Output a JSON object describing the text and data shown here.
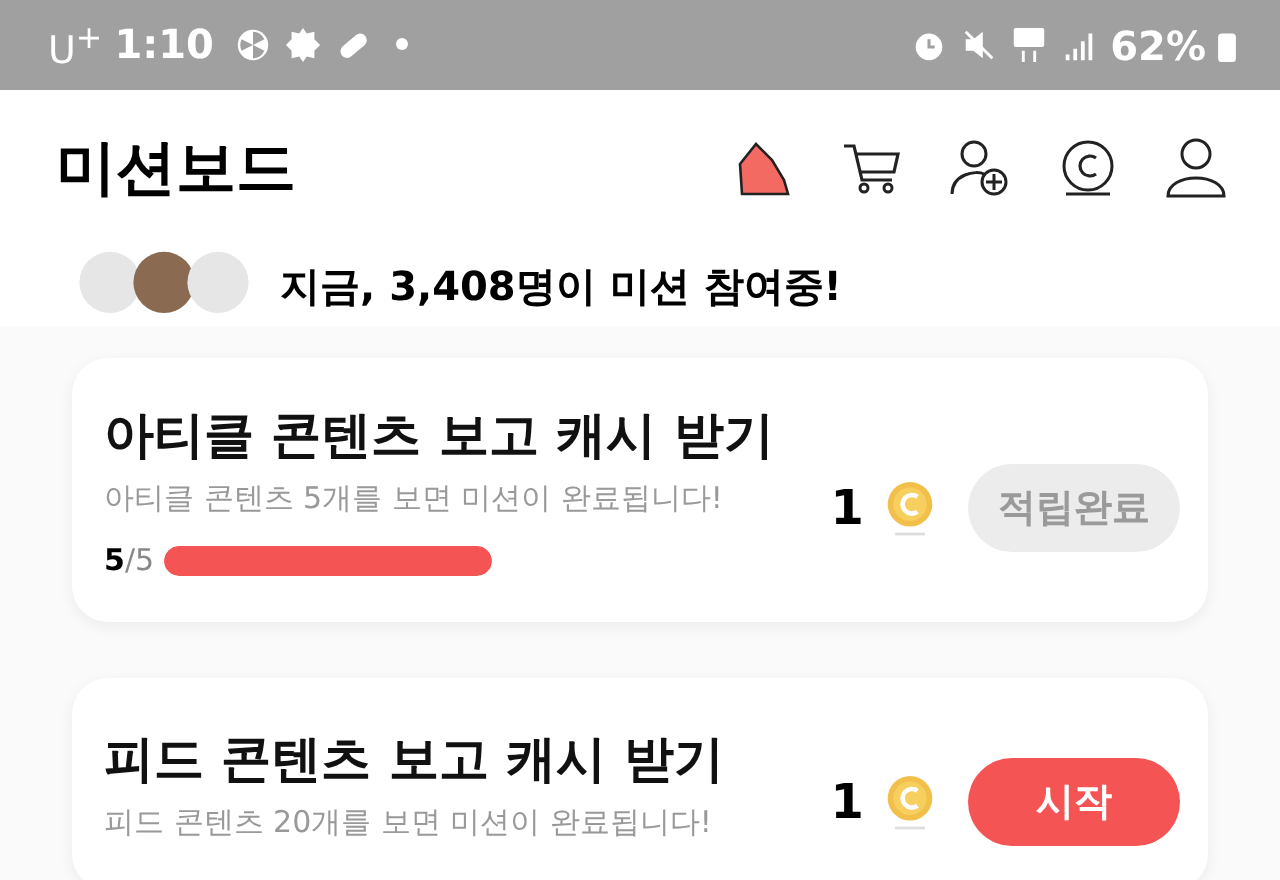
{
  "status_bar": {
    "carrier": "U$^{+}$",
    "time": "1:10",
    "battery": "62%"
  },
  "header": {
    "title": "미션보드"
  },
  "banner": {
    "text": "지금, **3,408명**이 미션 참여중!"
  },
  "missions": [
    {
      "title": "아티클 콘텐츠 보고 캐시 받기",
      "description": "아티클 콘텐츠 5개를 보면 미션이 완료됩니다!",
      "reward": "1",
      "progress": {
        "current": "5",
        "total": "/5",
        "level": 1
      },
      "button": {
        "label": "적립완료",
        "disabled": true
      }
    },
    {
      "title": "피드 콘텐츠 보고 캐시 받기",
      "description": "피드 콘텐츠 20개를 보면 미션이 완료됩니다!",
      "reward": "1",
      "button": {
        "label": "시작",
        "disabled": false
      }
    }
  ]
}
